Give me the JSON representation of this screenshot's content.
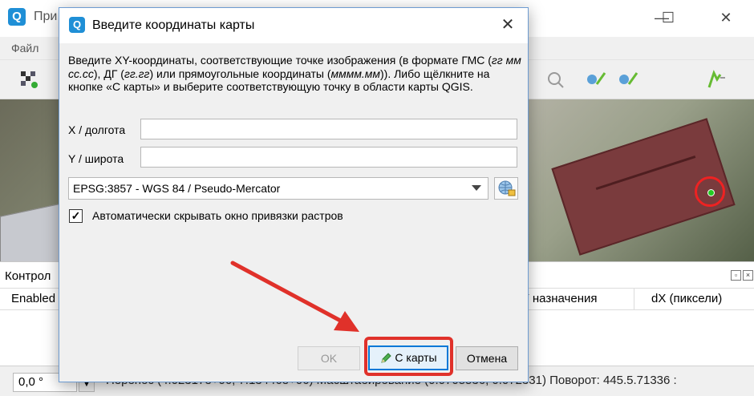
{
  "main_window": {
    "title": "При",
    "menu": [
      "Файл"
    ],
    "controls": {
      "minimize": "—",
      "maximize": "☐",
      "close": "✕"
    }
  },
  "gcp_panel": {
    "title": "Контрол",
    "columns": [
      "Enabled",
      "Y назначения",
      "dX (пиксели)"
    ]
  },
  "statusbar": {
    "rotation": "0,0 °",
    "text": "Перенос (4.02317e+06, 7.13446e+06) Масштабирование (0.0705536, 0.072331) Поворот: 445.5.71336 :"
  },
  "dialog": {
    "title": "Введите координаты карты",
    "close_glyph": "✕",
    "description_parts": [
      "Введите XY-координаты, соответствующие точке изображения (в формате ГМС (",
      "гг мм сс.сс",
      "), ДГ (",
      "гг.гг",
      ") или прямоугольные координаты (",
      "мммм.мм",
      ")). Либо щёлкните на кнопке «С карты» и выберите соответствующую точку в области карты QGIS."
    ],
    "x_label": "X / долгота",
    "x_value": "",
    "y_label": "Y / широта",
    "y_value": "",
    "crs": "EPSG:3857 - WGS 84 / Pseudo-Mercator",
    "autohide_checked": true,
    "autohide_label": "Автоматически скрывать окно привязки растров",
    "ok_label": "OK",
    "from_map_label": "С карты",
    "cancel_label": "Отмена"
  },
  "icons": [
    "app-icon",
    "georeferencer-icon",
    "crs-globe-icon",
    "pencil-icon",
    "panel-float-icon",
    "panel-close-icon"
  ],
  "colors": {
    "accent": "#0078d7",
    "annotation": "#e0312a",
    "marker": "#22cc22"
  }
}
